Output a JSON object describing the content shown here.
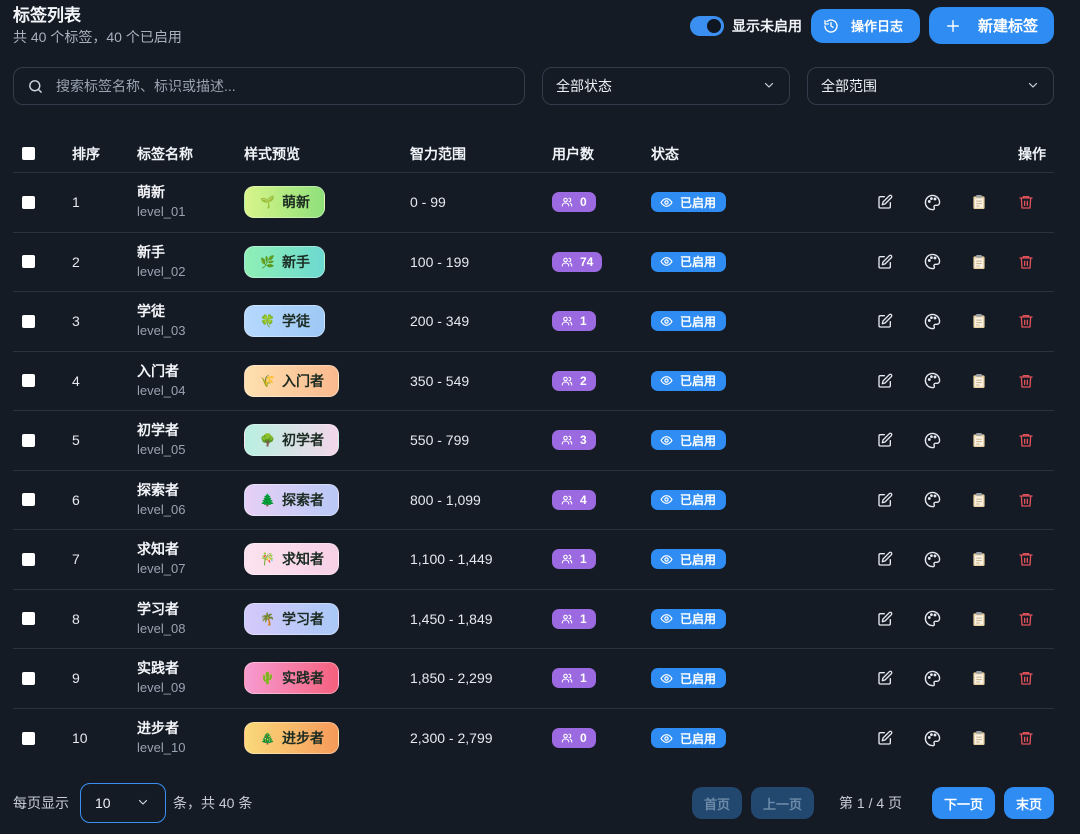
{
  "header": {
    "title": "标签列表",
    "subtitle": "共 40 个标签，40 个已启用",
    "toggle_label": "显示未启用",
    "toggle_on": true,
    "log_button": "操作日志",
    "new_button": "新建标签"
  },
  "filters": {
    "search_placeholder": "搜索标签名称、标识或描述...",
    "status_select": "全部状态",
    "range_select": "全部范围"
  },
  "table": {
    "headers": {
      "order": "排序",
      "name": "标签名称",
      "preview": "样式预览",
      "range": "智力范围",
      "users": "用户数",
      "status": "状态",
      "ops": "操作"
    },
    "rows": [
      {
        "order": "1",
        "name": "萌新",
        "key": "level_01",
        "emoji": "🌱",
        "range": "0 - 99",
        "users": "0",
        "status": "已启用",
        "gradient": [
          "#d8f58a",
          "#8fe07a"
        ]
      },
      {
        "order": "2",
        "name": "新手",
        "key": "level_02",
        "emoji": "🌿",
        "range": "100 - 199",
        "users": "74",
        "status": "已启用",
        "gradient": [
          "#8ff0b5",
          "#6cd9d0"
        ]
      },
      {
        "order": "3",
        "name": "学徒",
        "key": "level_03",
        "emoji": "🍀",
        "range": "200 - 349",
        "users": "1",
        "status": "已启用",
        "gradient": [
          "#b6d8ff",
          "#9ec8f5"
        ]
      },
      {
        "order": "4",
        "name": "入门者",
        "key": "level_04",
        "emoji": "🌾",
        "range": "350 - 549",
        "users": "2",
        "status": "已启用",
        "gradient": [
          "#ffe0b0",
          "#f9b98d"
        ]
      },
      {
        "order": "5",
        "name": "初学者",
        "key": "level_05",
        "emoji": "🌳",
        "range": "550 - 799",
        "users": "3",
        "status": "已启用",
        "gradient": [
          "#b9f0e0",
          "#f3d6ea"
        ]
      },
      {
        "order": "6",
        "name": "探索者",
        "key": "level_06",
        "emoji": "🌲",
        "range": "800 - 1,099",
        "users": "4",
        "status": "已启用",
        "gradient": [
          "#e7d0f5",
          "#b9c8f6"
        ]
      },
      {
        "order": "7",
        "name": "求知者",
        "key": "level_07",
        "emoji": "🎋",
        "range": "1,100 - 1,449",
        "users": "1",
        "status": "已启用",
        "gradient": [
          "#fbe3ee",
          "#f7d0e6"
        ]
      },
      {
        "order": "8",
        "name": "学习者",
        "key": "level_08",
        "emoji": "🌴",
        "range": "1,450 - 1,849",
        "users": "1",
        "status": "已启用",
        "gradient": [
          "#d5c9fb",
          "#a9c8f7"
        ]
      },
      {
        "order": "9",
        "name": "实践者",
        "key": "level_09",
        "emoji": "🌵",
        "range": "1,850 - 2,299",
        "users": "1",
        "status": "已启用",
        "gradient": [
          "#f79bd0",
          "#f5607e"
        ]
      },
      {
        "order": "10",
        "name": "进步者",
        "key": "level_10",
        "emoji": "🎄",
        "range": "2,300 - 2,799",
        "users": "0",
        "status": "已启用",
        "gradient": [
          "#fbd97a",
          "#f59a5a"
        ]
      }
    ]
  },
  "footer": {
    "per_page_label": "每页显示",
    "page_size": "10",
    "total_label": "条，共 40 条",
    "first": "首页",
    "prev": "上一页",
    "page_info": "第 1 / 4 页",
    "next": "下一页",
    "last": "末页"
  },
  "colors": {
    "accent": "#2f8cf2",
    "users_badge": "#9b69e0",
    "delete": "#e0525a"
  }
}
